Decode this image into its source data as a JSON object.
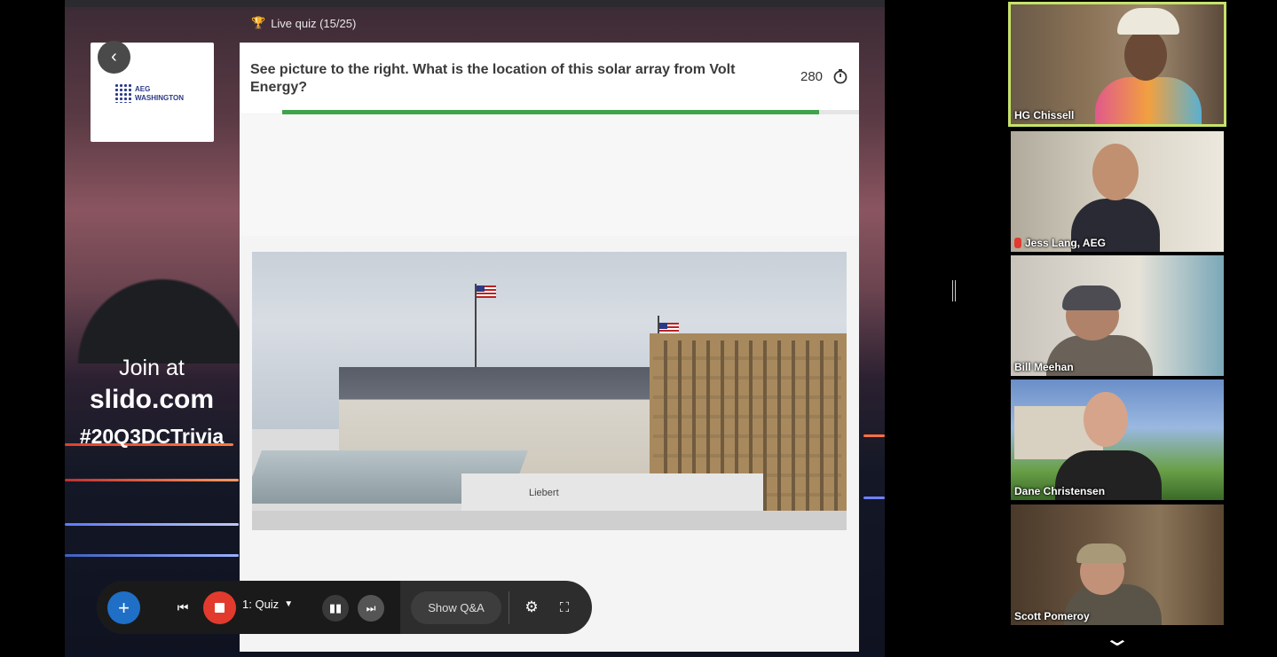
{
  "slido": {
    "quiz_label": "Live quiz (15/25)",
    "question": "See picture to the right. What is the location of this solar array from Volt Energy?",
    "score": "280",
    "timer_progress": 0.93,
    "logo_text_line1": "AEG",
    "logo_text_line2": "WASHINGTON",
    "join_line1": "Join at",
    "join_line2": "slido.com",
    "join_line3": "#20Q3DCTrivia",
    "photo_sign": "Liebert",
    "colors": {
      "progress": "#3fa34d",
      "plus_button": "#1f6fc6",
      "stop_button": "#e23b2e"
    }
  },
  "toolbar": {
    "mode_label": "1: Quiz",
    "qa_label": "Show Q&A",
    "icons": [
      "plus-icon",
      "previous-icon",
      "stop-icon",
      "results-icon",
      "next-icon",
      "gear-icon",
      "fullscreen-icon"
    ]
  },
  "gallery": {
    "participants": [
      {
        "name": "HG Chissell",
        "active": true,
        "muted": false
      },
      {
        "name": "Jess Lang, AEG",
        "active": false,
        "muted": true
      },
      {
        "name": "Bill Meehan",
        "active": false,
        "muted": false
      },
      {
        "name": "Dane Christensen",
        "active": false,
        "muted": false
      },
      {
        "name": "Scott Pomeroy",
        "active": false,
        "muted": false
      }
    ],
    "active_border_color": "#c6e26a"
  }
}
